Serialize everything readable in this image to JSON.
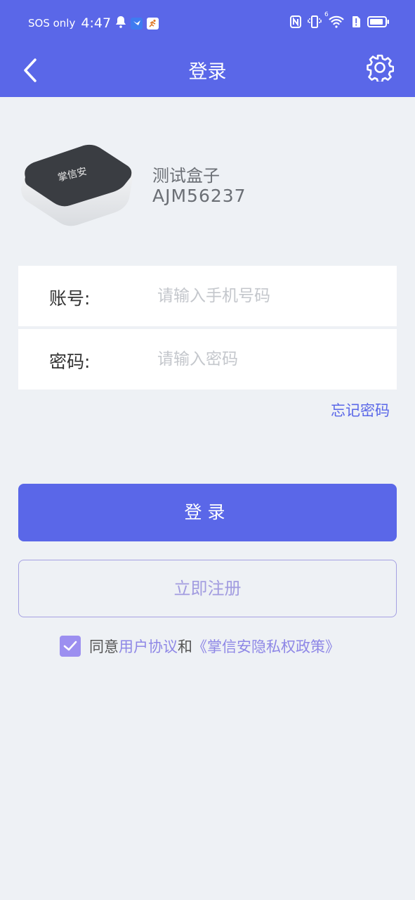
{
  "status_bar": {
    "carrier": "SOS only",
    "time": "4:47",
    "left_icons": [
      "bell-icon",
      "feishu-app-icon",
      "runner-app-icon"
    ],
    "right_icons": [
      "nfc-icon",
      "vibrate-icon",
      "wifi-6-icon",
      "sim-alert-icon",
      "battery-icon"
    ],
    "wifi_label": "6"
  },
  "header": {
    "title": "登录",
    "back_icon": "chevron-left-icon",
    "settings_icon": "gear-icon"
  },
  "device": {
    "image_label": "掌信安",
    "name": "测试盒子",
    "id": "AJM56237"
  },
  "form": {
    "account": {
      "label": "账号:",
      "placeholder": "请输入手机号码",
      "value": ""
    },
    "password": {
      "label": "密码:",
      "placeholder": "请输入密码",
      "value": ""
    },
    "forgot_password": "忘记密码"
  },
  "buttons": {
    "login": "登录",
    "register": "立即注册"
  },
  "agreement": {
    "checked": true,
    "prefix": "同意",
    "user_agreement": "用户协议",
    "conjunction": "和",
    "privacy_policy": "《掌信安隐私权政策》"
  },
  "colors": {
    "primary": "#5a67e8",
    "link": "#8e87e6",
    "background": "#eef1f5"
  }
}
